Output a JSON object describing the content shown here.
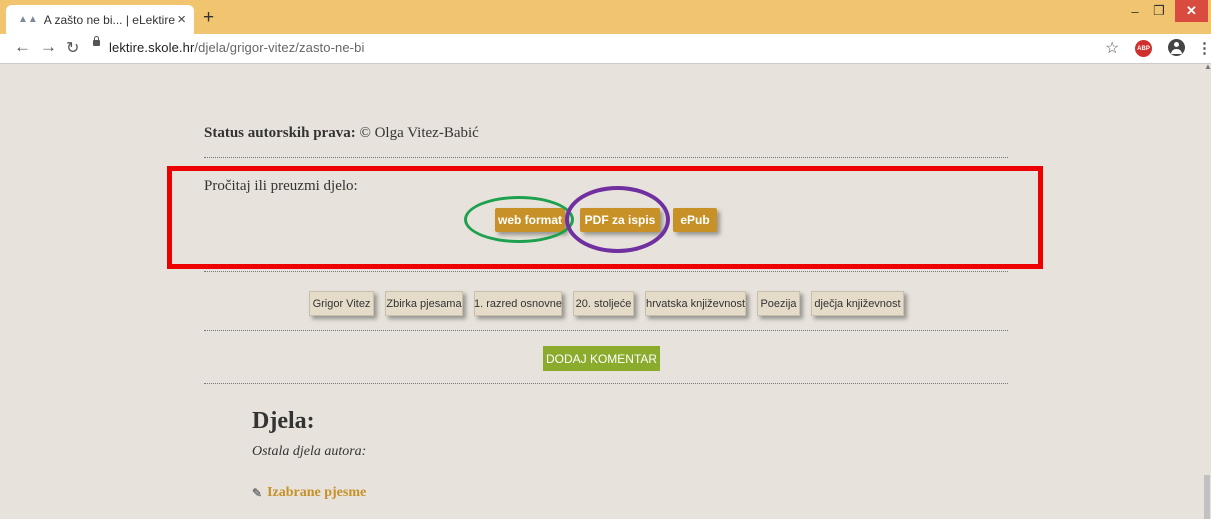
{
  "browser": {
    "tab_title": "A zašto ne bi... | eLektire",
    "tab_icon": "book-favicon-icon",
    "url_domain": "lektire.skole.hr",
    "url_path": "/djela/grigor-vitez/zasto-ne-bi",
    "abp_label": "ABP",
    "new_tab_glyph": "+",
    "close_glyph": "×"
  },
  "page": {
    "status_label": "Status autorskih prava:",
    "status_value": "© Olga Vitez-Babić",
    "read_label": "Pročitaj ili preuzmi djelo:",
    "formats": [
      "web format",
      "PDF za ispis",
      "ePub"
    ],
    "tags": [
      "Grigor Vitez",
      "Zbirka pjesama",
      "1. razred osnovne",
      "20. stoljeće",
      "hrvatska književnost",
      "Poezija",
      "dječja književnost"
    ],
    "comment_button": "DODAJ KOMENTAR",
    "works_heading": "Djela:",
    "works_subtitle": "Ostala djela autora:",
    "work_link": "Izabrane pjesme"
  },
  "annotations": {
    "red_box_color": "#ee0000",
    "green_ring_color": "#1ea14e",
    "purple_ring_color": "#7030a0"
  },
  "colors": {
    "chrome_accent": "#f1c46f",
    "button_orange": "#c79128",
    "comment_green": "#8bab2d",
    "page_background": "#e7e3dc"
  }
}
